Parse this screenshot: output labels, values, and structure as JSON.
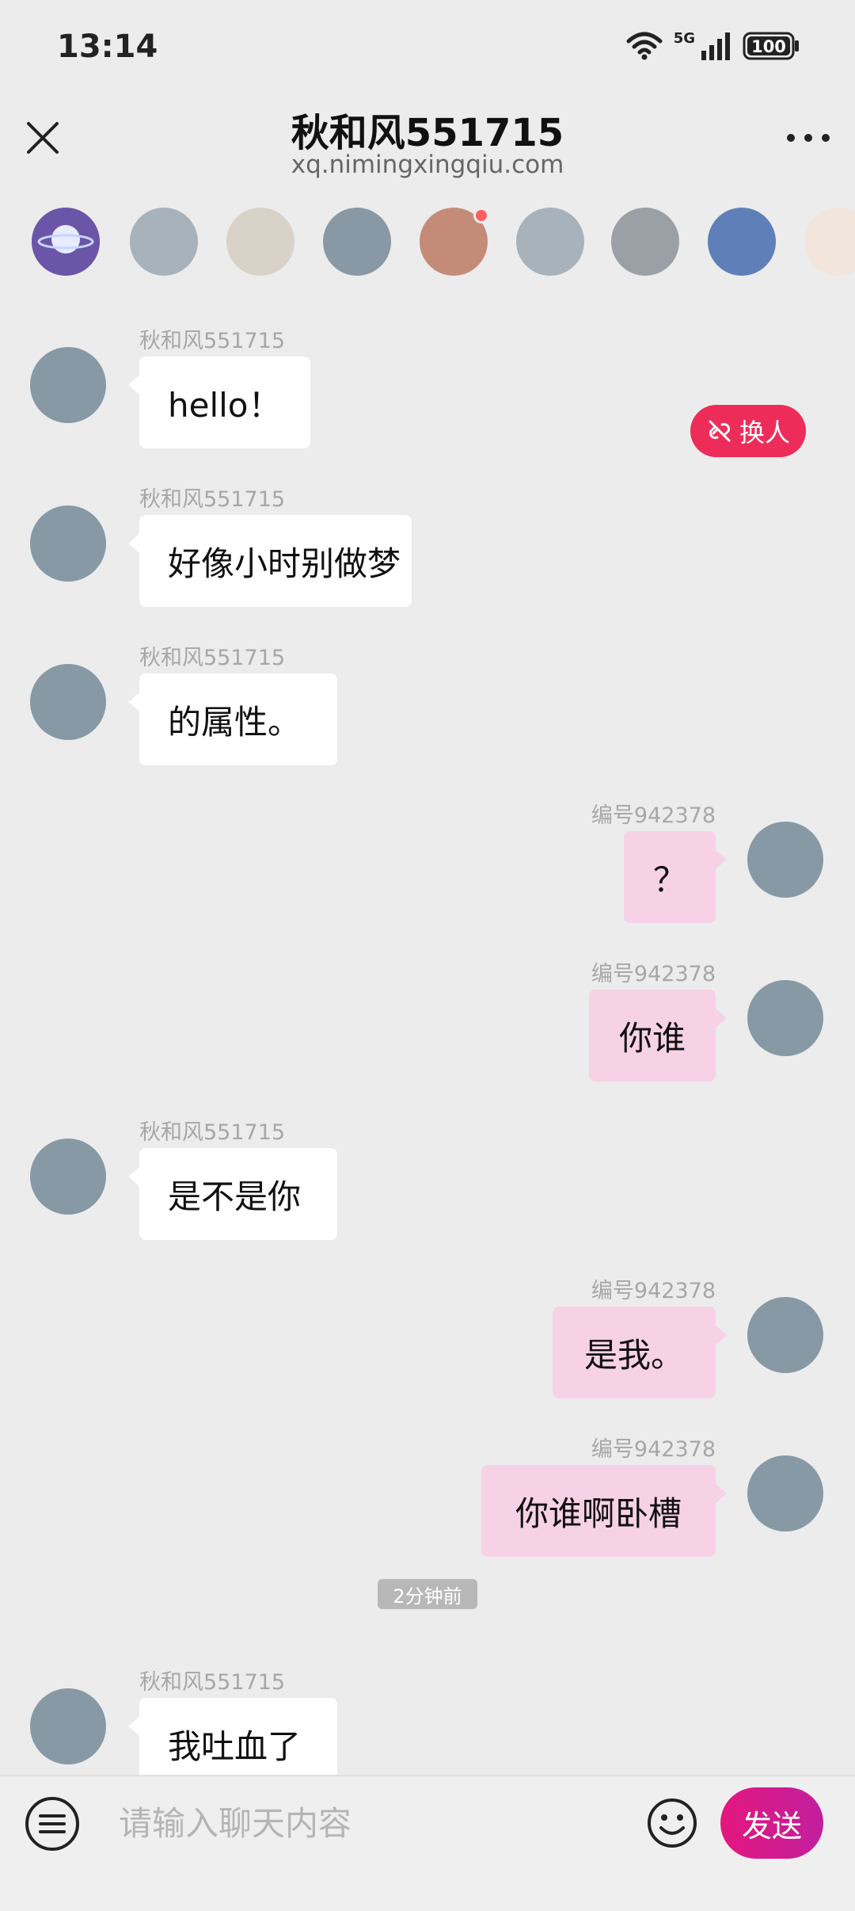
{
  "status_bar": {
    "time": "13:14",
    "network": "5G",
    "battery": "100"
  },
  "header": {
    "title": "秋和风551715",
    "subtitle": "xq.nimingxingqiu.com"
  },
  "avatar_strip": [
    {
      "name": "planet-avatar",
      "color": "#6a55a8"
    },
    {
      "name": "grey-avatar",
      "color": "#a7b2bb"
    },
    {
      "name": "cat-avatar",
      "color": "#d8d2c8"
    },
    {
      "name": "dark-grey-avatar",
      "color": "#8898a5"
    },
    {
      "name": "girl-avatar",
      "color": "#c58b79",
      "has_notification": true
    },
    {
      "name": "grey-avatar-2",
      "color": "#a7b2bb"
    },
    {
      "name": "character-avatar",
      "color": "#9aa0a6"
    },
    {
      "name": "blue-cat-avatar",
      "color": "#5f7fb8"
    },
    {
      "name": "cartoon-cat-avatar",
      "color": "#f2e6dc"
    }
  ],
  "switch_button": {
    "label": "换人"
  },
  "messages": [
    {
      "direction": "in",
      "sender": "秋和风551715",
      "text": "hello！"
    },
    {
      "direction": "in",
      "sender": "秋和风551715",
      "text": "好像小时别做梦"
    },
    {
      "direction": "in",
      "sender": "秋和风551715",
      "text": "的属性。"
    },
    {
      "direction": "out",
      "sender": "编号942378",
      "text": "？"
    },
    {
      "direction": "out",
      "sender": "编号942378",
      "text": "你谁"
    },
    {
      "direction": "in",
      "sender": "秋和风551715",
      "text": "是不是你"
    },
    {
      "direction": "out",
      "sender": "编号942378",
      "text": "是我。"
    },
    {
      "direction": "out",
      "sender": "编号942378",
      "text": "你谁啊卧槽"
    },
    {
      "direction": "in",
      "sender": "秋和风551715",
      "text": "我吐血了"
    }
  ],
  "time_divider": "2分钟前",
  "input_bar": {
    "placeholder": "请输入聊天内容",
    "send_label": "发送"
  },
  "colors": {
    "background": "#ececec",
    "incoming_bubble": "#ffffff",
    "outgoing_bubble": "#f7d2e6",
    "avatar_placeholder": "#8899a6",
    "accent": "#e3177e",
    "switch_button": "#ee2c5a"
  }
}
